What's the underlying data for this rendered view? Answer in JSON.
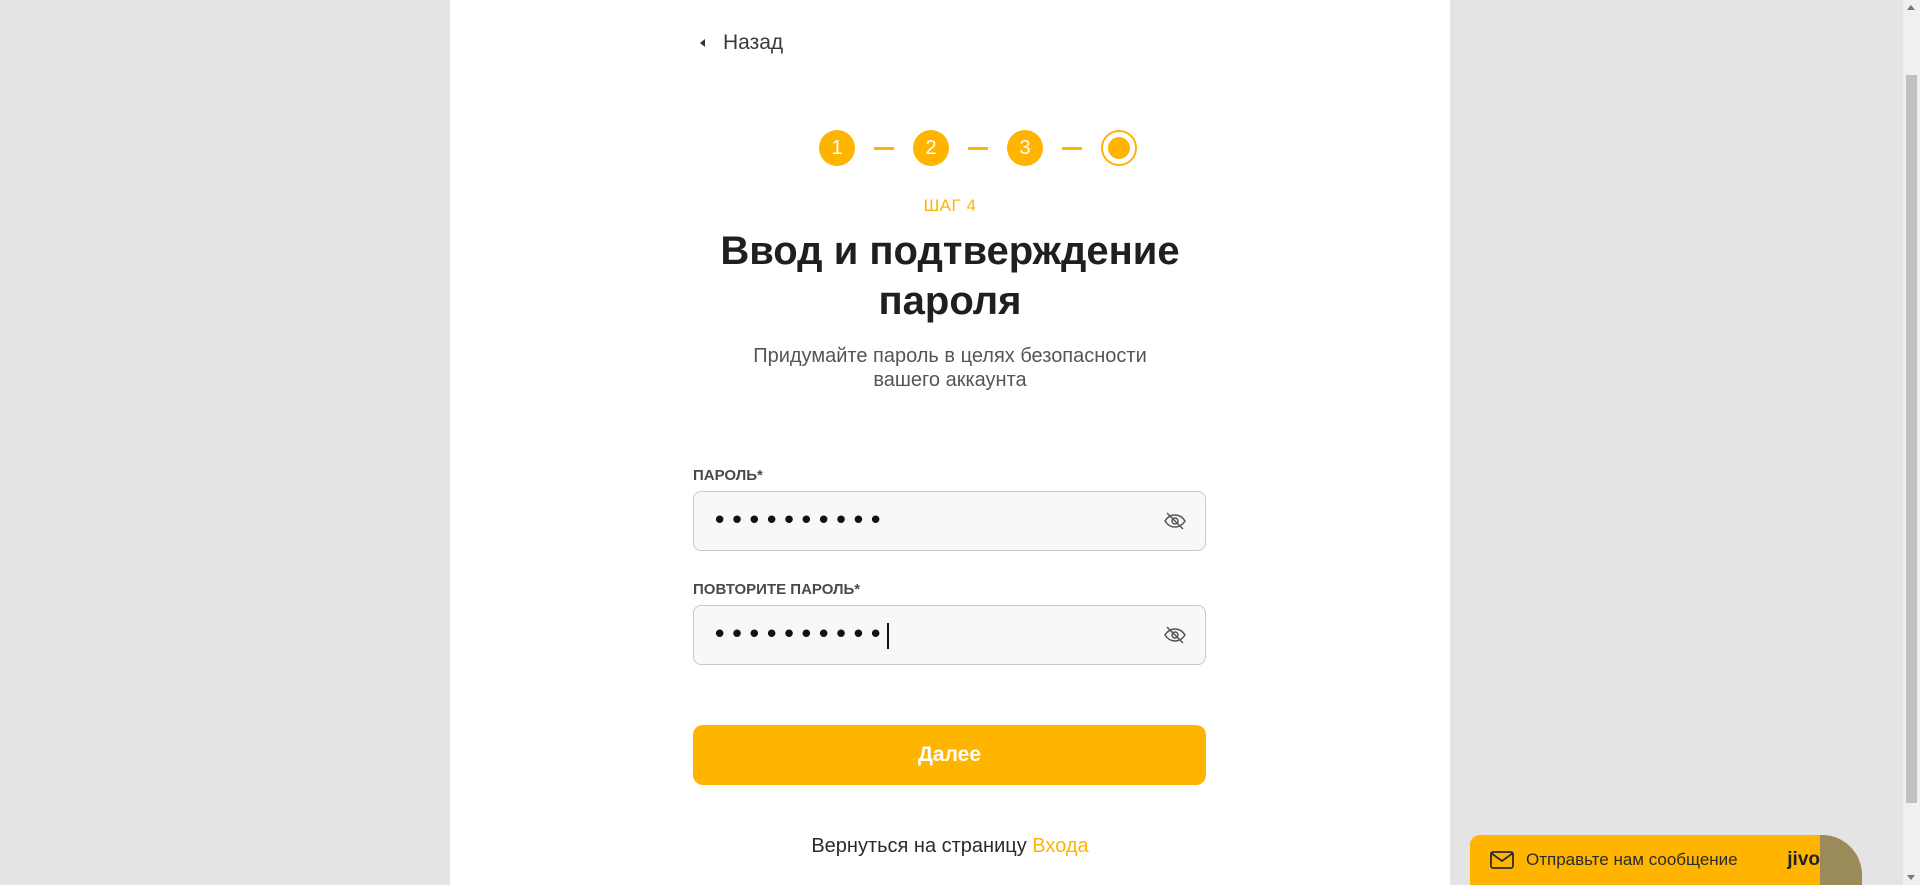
{
  "nav": {
    "back_label": "Назад"
  },
  "stepper": {
    "steps": [
      "1",
      "2",
      "3"
    ],
    "current_label": "ШАГ 4"
  },
  "header": {
    "title_line1": "Ввод и подтверждение",
    "title_line2": "пароля",
    "subtitle_line1": "Придумайте пароль в целях безопасности",
    "subtitle_line2": "вашего аккаунта"
  },
  "form": {
    "password_label": "ПАРОЛЬ*",
    "password_value": "••••••••••",
    "confirm_label": "ПОВТОРИТЕ ПАРОЛЬ*",
    "confirm_value": "••••••••••",
    "submit_label": "Далее"
  },
  "footer": {
    "text": "Вернуться на страницу ",
    "link_label": "Входа"
  },
  "chat_widget": {
    "text": "Отправьте нам сообщение",
    "brand": "jivo"
  },
  "colors": {
    "accent": "#ffb400",
    "background": "#e4e4e4",
    "card": "#ffffff"
  }
}
